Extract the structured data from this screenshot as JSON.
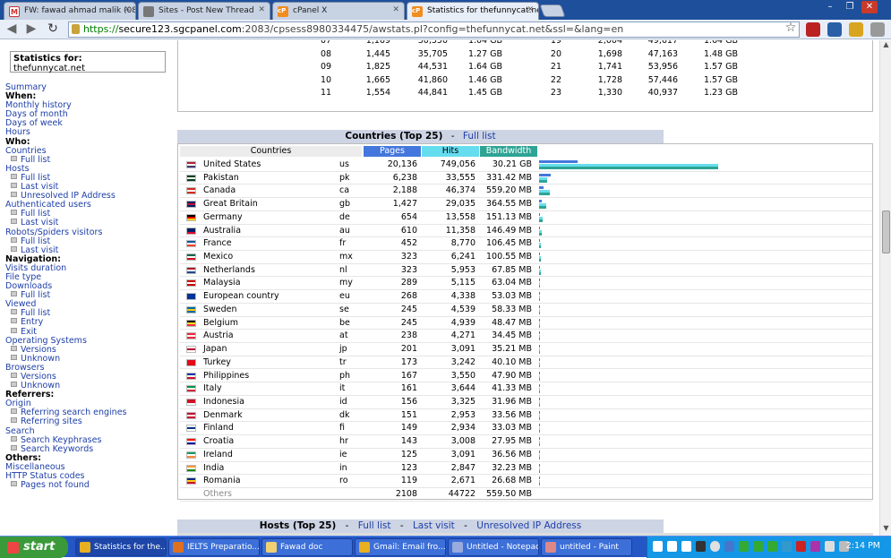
{
  "browser": {
    "tabs": [
      {
        "label": "FW: fawad ahmad malik (08/0",
        "active": false,
        "icon": "gmail-icon"
      },
      {
        "label": "Sites - Post New Thread",
        "active": false,
        "icon": "forum-icon"
      },
      {
        "label": "cPanel X",
        "active": false,
        "icon": "cpanel-icon"
      },
      {
        "label": "Statistics for thefunnycat.net",
        "active": true,
        "icon": "cpanel-icon"
      }
    ],
    "url_scheme": "https://",
    "url_host": "secure123.sgcpanel.com",
    "url_rest": ":2083/cpsess8980334475/awstats.pl?config=thefunnycat.net&ssl=&lang=en"
  },
  "sidebar": {
    "stats_label": "Statistics for:",
    "stats_site": "thefunnycat.net",
    "items": [
      {
        "type": "link",
        "label": "Summary"
      },
      {
        "type": "head",
        "label": "When:"
      },
      {
        "type": "link",
        "label": "Monthly history"
      },
      {
        "type": "link",
        "label": "Days of month"
      },
      {
        "type": "link",
        "label": "Days of week"
      },
      {
        "type": "link",
        "label": "Hours"
      },
      {
        "type": "head",
        "label": "Who:"
      },
      {
        "type": "link",
        "label": "Countries"
      },
      {
        "type": "sub",
        "label": "Full list"
      },
      {
        "type": "link",
        "label": "Hosts"
      },
      {
        "type": "sub",
        "label": "Full list"
      },
      {
        "type": "sub",
        "label": "Last visit"
      },
      {
        "type": "sub",
        "label": "Unresolved IP Address"
      },
      {
        "type": "link",
        "label": "Authenticated users"
      },
      {
        "type": "sub",
        "label": "Full list"
      },
      {
        "type": "sub",
        "label": "Last visit"
      },
      {
        "type": "link",
        "label": "Robots/Spiders visitors"
      },
      {
        "type": "sub",
        "label": "Full list"
      },
      {
        "type": "sub",
        "label": "Last visit"
      },
      {
        "type": "head",
        "label": "Navigation:"
      },
      {
        "type": "link",
        "label": "Visits duration"
      },
      {
        "type": "link",
        "label": "File type"
      },
      {
        "type": "link",
        "label": "Downloads"
      },
      {
        "type": "sub",
        "label": "Full list"
      },
      {
        "type": "link",
        "label": "Viewed"
      },
      {
        "type": "sub",
        "label": "Full list"
      },
      {
        "type": "sub",
        "label": "Entry"
      },
      {
        "type": "sub",
        "label": "Exit"
      },
      {
        "type": "link",
        "label": "Operating Systems"
      },
      {
        "type": "sub",
        "label": "Versions"
      },
      {
        "type": "sub",
        "label": "Unknown"
      },
      {
        "type": "link",
        "label": "Browsers"
      },
      {
        "type": "sub",
        "label": "Versions"
      },
      {
        "type": "sub",
        "label": "Unknown"
      },
      {
        "type": "head",
        "label": "Referrers:"
      },
      {
        "type": "link",
        "label": "Origin"
      },
      {
        "type": "sub",
        "label": "Referring search engines"
      },
      {
        "type": "sub",
        "label": "Referring sites"
      },
      {
        "type": "link",
        "label": "Search"
      },
      {
        "type": "sub",
        "label": "Search Keyphrases"
      },
      {
        "type": "sub",
        "label": "Search Keywords"
      },
      {
        "type": "head",
        "label": "Others:"
      },
      {
        "type": "link",
        "label": "Miscellaneous"
      },
      {
        "type": "link",
        "label": "HTTP Status codes"
      },
      {
        "type": "sub",
        "label": "Pages not found"
      }
    ]
  },
  "hours_table": {
    "rows": [
      {
        "h1": "07",
        "p1": "1,169",
        "hits1": "30,550",
        "bw1": "1.04 GB",
        "h2": "19",
        "p2": "2,004",
        "hits2": "49,617",
        "bw2": "1.64 GB"
      },
      {
        "h1": "08",
        "p1": "1,445",
        "hits1": "35,705",
        "bw1": "1.27 GB",
        "h2": "20",
        "p2": "1,698",
        "hits2": "47,163",
        "bw2": "1.48 GB"
      },
      {
        "h1": "09",
        "p1": "1,825",
        "hits1": "44,531",
        "bw1": "1.64 GB",
        "h2": "21",
        "p2": "1,741",
        "hits2": "53,956",
        "bw2": "1.57 GB"
      },
      {
        "h1": "10",
        "p1": "1,665",
        "hits1": "41,860",
        "bw1": "1.46 GB",
        "h2": "22",
        "p2": "1,728",
        "hits2": "57,446",
        "bw2": "1.57 GB"
      },
      {
        "h1": "11",
        "p1": "1,554",
        "hits1": "44,841",
        "bw1": "1.45 GB",
        "h2": "23",
        "p2": "1,330",
        "hits2": "40,937",
        "bw2": "1.23 GB"
      }
    ]
  },
  "countries": {
    "title": "Countries (Top 25)",
    "sep": "-",
    "full_list": "Full list",
    "col_countries": "Countries",
    "col_pages": "Pages",
    "col_hits": "Hits",
    "col_bandwidth": "Bandwidth",
    "colors": {
      "pages": "#4477dd",
      "hits": "#66ddee",
      "bandwidth": "#2ea495"
    },
    "max_hits": 749056,
    "rows": [
      {
        "name": "United States",
        "code": "us",
        "pages": "20,136",
        "hits": "749,056",
        "bw": "30.21 GB",
        "pages_n": 20136,
        "hits_n": 749056,
        "flag": [
          "#b22234",
          "#ffffff",
          "#3c3b6e"
        ]
      },
      {
        "name": "Pakistan",
        "code": "pk",
        "pages": "6,238",
        "hits": "33,555",
        "bw": "331.42 MB",
        "pages_n": 6238,
        "hits_n": 33555,
        "flag": [
          "#01411c",
          "#ffffff",
          "#01411c"
        ]
      },
      {
        "name": "Canada",
        "code": "ca",
        "pages": "2,188",
        "hits": "46,374",
        "bw": "559.20 MB",
        "pages_n": 2188,
        "hits_n": 46374,
        "flag": [
          "#d52b1e",
          "#ffffff",
          "#d52b1e"
        ]
      },
      {
        "name": "Great Britain",
        "code": "gb",
        "pages": "1,427",
        "hits": "29,035",
        "bw": "364.55 MB",
        "pages_n": 1427,
        "hits_n": 29035,
        "flag": [
          "#012169",
          "#c8102e",
          "#012169"
        ]
      },
      {
        "name": "Germany",
        "code": "de",
        "pages": "654",
        "hits": "13,558",
        "bw": "151.13 MB",
        "pages_n": 654,
        "hits_n": 13558,
        "flag": [
          "#000000",
          "#dd0000",
          "#ffce00"
        ]
      },
      {
        "name": "Australia",
        "code": "au",
        "pages": "610",
        "hits": "11,358",
        "bw": "146.49 MB",
        "pages_n": 610,
        "hits_n": 11358,
        "flag": [
          "#012169",
          "#012169",
          "#e4002b"
        ]
      },
      {
        "name": "France",
        "code": "fr",
        "pages": "452",
        "hits": "8,770",
        "bw": "106.45 MB",
        "pages_n": 452,
        "hits_n": 8770,
        "flag": [
          "#0055a4",
          "#ffffff",
          "#ef4135"
        ]
      },
      {
        "name": "Mexico",
        "code": "mx",
        "pages": "323",
        "hits": "6,241",
        "bw": "100.55 MB",
        "pages_n": 323,
        "hits_n": 6241,
        "flag": [
          "#006847",
          "#ffffff",
          "#ce1126"
        ]
      },
      {
        "name": "Netherlands",
        "code": "nl",
        "pages": "323",
        "hits": "5,953",
        "bw": "67.85 MB",
        "pages_n": 323,
        "hits_n": 5953,
        "flag": [
          "#ae1c28",
          "#ffffff",
          "#21468b"
        ]
      },
      {
        "name": "Malaysia",
        "code": "my",
        "pages": "289",
        "hits": "5,115",
        "bw": "63.04 MB",
        "pages_n": 289,
        "hits_n": 5115,
        "flag": [
          "#cc0001",
          "#ffffff",
          "#cc0001"
        ]
      },
      {
        "name": "European country",
        "code": "eu",
        "pages": "268",
        "hits": "4,338",
        "bw": "53.03 MB",
        "pages_n": 268,
        "hits_n": 4338,
        "flag": [
          "#003399",
          "#003399",
          "#003399"
        ]
      },
      {
        "name": "Sweden",
        "code": "se",
        "pages": "245",
        "hits": "4,539",
        "bw": "58.33 MB",
        "pages_n": 245,
        "hits_n": 4539,
        "flag": [
          "#006aa7",
          "#fecc00",
          "#006aa7"
        ]
      },
      {
        "name": "Belgium",
        "code": "be",
        "pages": "245",
        "hits": "4,939",
        "bw": "48.47 MB",
        "pages_n": 245,
        "hits_n": 4939,
        "flag": [
          "#000000",
          "#fdda24",
          "#ef3340"
        ]
      },
      {
        "name": "Austria",
        "code": "at",
        "pages": "238",
        "hits": "4,271",
        "bw": "34.45 MB",
        "pages_n": 238,
        "hits_n": 4271,
        "flag": [
          "#ed2939",
          "#ffffff",
          "#ed2939"
        ]
      },
      {
        "name": "Japan",
        "code": "jp",
        "pages": "201",
        "hits": "3,091",
        "bw": "35.21 MB",
        "pages_n": 201,
        "hits_n": 3091,
        "flag": [
          "#ffffff",
          "#bc002d",
          "#ffffff"
        ]
      },
      {
        "name": "Turkey",
        "code": "tr",
        "pages": "173",
        "hits": "3,242",
        "bw": "40.10 MB",
        "pages_n": 173,
        "hits_n": 3242,
        "flag": [
          "#e30a17",
          "#e30a17",
          "#e30a17"
        ]
      },
      {
        "name": "Philippines",
        "code": "ph",
        "pages": "167",
        "hits": "3,550",
        "bw": "47.90 MB",
        "pages_n": 167,
        "hits_n": 3550,
        "flag": [
          "#0038a8",
          "#ffffff",
          "#ce1126"
        ]
      },
      {
        "name": "Italy",
        "code": "it",
        "pages": "161",
        "hits": "3,644",
        "bw": "41.33 MB",
        "pages_n": 161,
        "hits_n": 3644,
        "flag": [
          "#009246",
          "#ffffff",
          "#ce2b37"
        ]
      },
      {
        "name": "Indonesia",
        "code": "id",
        "pages": "156",
        "hits": "3,325",
        "bw": "31.96 MB",
        "pages_n": 156,
        "hits_n": 3325,
        "flag": [
          "#ce1126",
          "#ce1126",
          "#ffffff"
        ]
      },
      {
        "name": "Denmark",
        "code": "dk",
        "pages": "151",
        "hits": "2,953",
        "bw": "33.56 MB",
        "pages_n": 151,
        "hits_n": 2953,
        "flag": [
          "#c60c30",
          "#ffffff",
          "#c60c30"
        ]
      },
      {
        "name": "Finland",
        "code": "fi",
        "pages": "149",
        "hits": "2,934",
        "bw": "33.03 MB",
        "pages_n": 149,
        "hits_n": 2934,
        "flag": [
          "#ffffff",
          "#003580",
          "#ffffff"
        ]
      },
      {
        "name": "Croatia",
        "code": "hr",
        "pages": "143",
        "hits": "3,008",
        "bw": "27.95 MB",
        "pages_n": 143,
        "hits_n": 3008,
        "flag": [
          "#ff0000",
          "#ffffff",
          "#171796"
        ]
      },
      {
        "name": "Ireland",
        "code": "ie",
        "pages": "125",
        "hits": "3,091",
        "bw": "36.56 MB",
        "pages_n": 125,
        "hits_n": 3091,
        "flag": [
          "#169b62",
          "#ffffff",
          "#ff883e"
        ]
      },
      {
        "name": "India",
        "code": "in",
        "pages": "123",
        "hits": "2,847",
        "bw": "32.23 MB",
        "pages_n": 123,
        "hits_n": 2847,
        "flag": [
          "#ff9933",
          "#ffffff",
          "#138808"
        ]
      },
      {
        "name": "Romania",
        "code": "ro",
        "pages": "119",
        "hits": "2,671",
        "bw": "26.68 MB",
        "pages_n": 119,
        "hits_n": 2671,
        "flag": [
          "#002b7f",
          "#fcd116",
          "#ce1126"
        ]
      }
    ],
    "others": {
      "name": "Others",
      "pages": "2108",
      "hits": "44722",
      "bw": "559.50 MB"
    }
  },
  "hosts": {
    "title": "Hosts (Top 25)",
    "sep": "-",
    "full_list": "Full list",
    "last_visit": "Last visit",
    "unresolved": "Unresolved IP Address"
  },
  "taskbar": {
    "start": "start",
    "items": [
      {
        "label": "Statistics for the...",
        "icon": "chrome-icon",
        "active": true
      },
      {
        "label": "IELTS Preparatio...",
        "icon": "firefox-icon",
        "active": false
      },
      {
        "label": "Fawad doc",
        "icon": "folder-icon",
        "active": false
      },
      {
        "label": "Gmail: Email fro...",
        "icon": "chrome-icon",
        "active": false
      },
      {
        "label": "Untitled - Notepad",
        "icon": "notepad-icon",
        "active": false
      },
      {
        "label": "untitled - Paint",
        "icon": "paint-icon",
        "active": false
      }
    ],
    "clock": "2:14 PM"
  }
}
